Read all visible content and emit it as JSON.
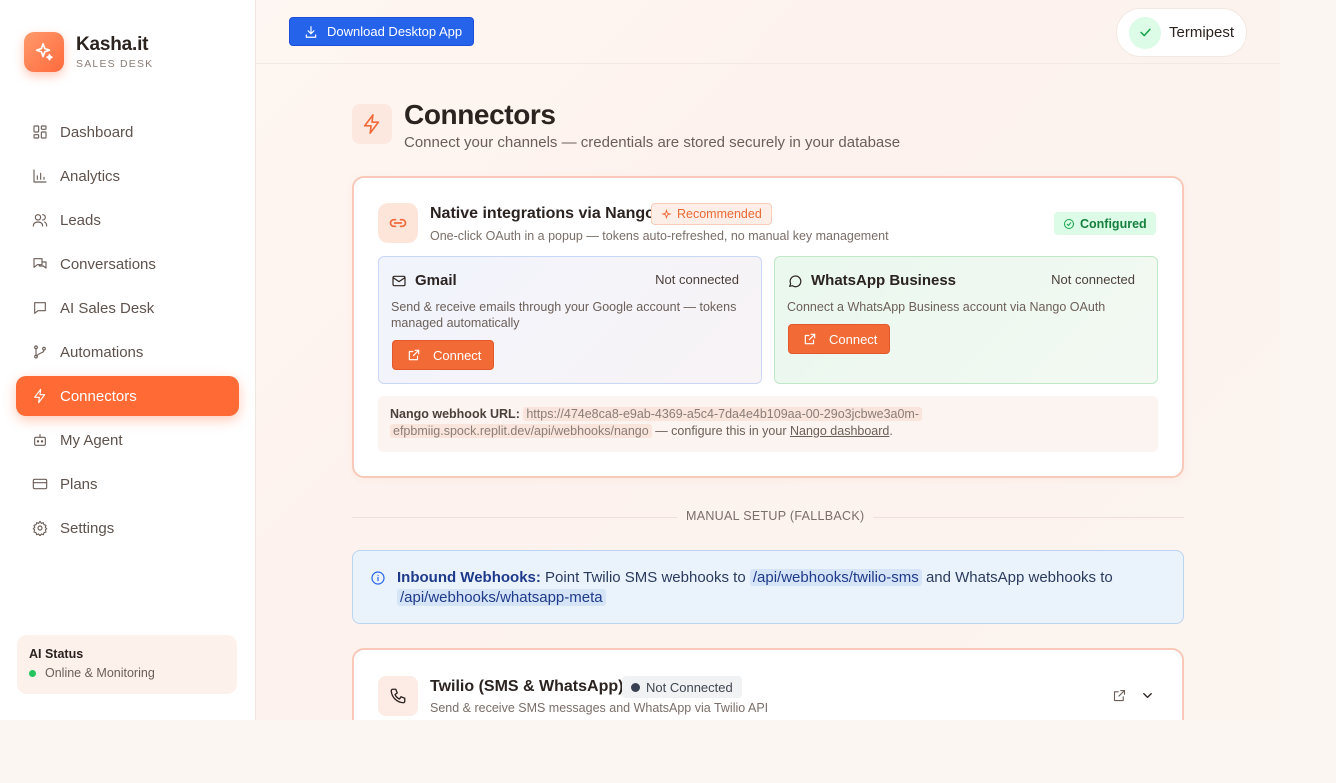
{
  "brand": {
    "name": "Kasha.it",
    "subtitle": "SALES DESK"
  },
  "sidebar": {
    "items": [
      {
        "label": "Dashboard",
        "icon": "grid-icon"
      },
      {
        "label": "Analytics",
        "icon": "bar-chart-icon"
      },
      {
        "label": "Leads",
        "icon": "users-icon"
      },
      {
        "label": "Conversations",
        "icon": "chat-bubbles-icon"
      },
      {
        "label": "AI Sales Desk",
        "icon": "message-square-icon"
      },
      {
        "label": "Automations",
        "icon": "git-branch-icon"
      },
      {
        "label": "Connectors",
        "icon": "lightning-icon",
        "active": true
      },
      {
        "label": "My Agent",
        "icon": "bot-icon"
      },
      {
        "label": "Plans",
        "icon": "credit-card-icon"
      },
      {
        "label": "Settings",
        "icon": "gear-icon"
      }
    ],
    "ai_status": {
      "title": "AI Status",
      "status": "Online & Monitoring"
    }
  },
  "topbar": {
    "download_label": "Download Desktop App",
    "user_name": "Termipest"
  },
  "page": {
    "title": "Connectors",
    "subtitle": "Connect your channels — credentials are stored securely in your database"
  },
  "nango": {
    "title": "Native integrations via Nango",
    "badge": "Recommended",
    "description": "One-click OAuth in a popup — tokens auto-refreshed, no manual key management",
    "status": "Configured",
    "gmail": {
      "name": "Gmail",
      "status": "Not connected",
      "description": "Send & receive emails through your Google account — tokens managed automatically",
      "button": "Connect"
    },
    "whatsapp": {
      "name": "WhatsApp Business",
      "status": "Not connected",
      "description": "Connect a WhatsApp Business account via Nango OAuth",
      "button": "Connect"
    },
    "webhook": {
      "label": "Nango webhook URL:",
      "url_line1": "https://474e8ca8-e9ab-4369-a5c4-7da4e4b109aa-00-29o3jcbwe3a0m-",
      "url_line2": "efpbmiig.spock.replit.dev/api/webhooks/nango",
      "suffix": " — configure this in your ",
      "link": "Nango dashboard",
      "end": "."
    }
  },
  "divider_label": "MANUAL SETUP (FALLBACK)",
  "info": {
    "strong": "Inbound Webhooks:",
    "text1": " Point Twilio SMS webhooks to ",
    "code1": "/api/webhooks/twilio-sms",
    "text2": " and WhatsApp webhooks to ",
    "code2": "/api/webhooks/whatsapp-meta"
  },
  "twilio": {
    "title": "Twilio (SMS & WhatsApp)",
    "badge": "Not Connected",
    "description": "Send & receive SMS messages and WhatsApp via Twilio API"
  },
  "colors": {
    "accent": "#ff6a35",
    "download": "#2563eb",
    "configured": "#15803d",
    "online": "#22c55e"
  }
}
